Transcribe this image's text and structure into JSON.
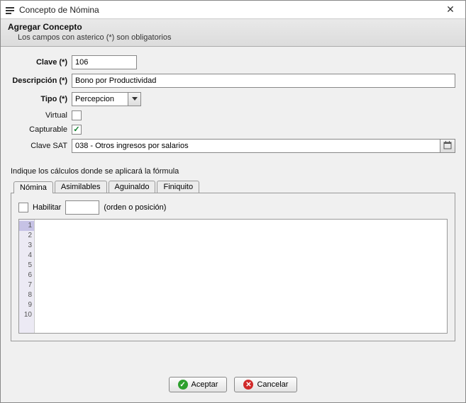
{
  "window": {
    "title": "Concepto de Nómina"
  },
  "header": {
    "title": "Agregar Concepto",
    "subtitle": "Los campos con asterico (*) son obligatorios"
  },
  "form": {
    "clave_label": "Clave (*)",
    "clave_value": "106",
    "descripcion_label": "Descripción (*)",
    "descripcion_value": "Bono por Productividad",
    "tipo_label": "Tipo (*)",
    "tipo_value": "Percepcion",
    "virtual_label": "Virtual",
    "virtual_checked": false,
    "capturable_label": "Capturable",
    "capturable_checked": true,
    "clavesat_label": "Clave SAT",
    "clavesat_value": "038 - Otros ingresos por salarios"
  },
  "tabs": {
    "instruction": "Indique los cálculos donde se aplicará la fórmula",
    "items": [
      "Nómina",
      "Asimilables",
      "Aguinaldo",
      "Finiquito"
    ],
    "active_index": 0,
    "panel": {
      "habilitar_label": "Habilitar",
      "habilitar_checked": false,
      "orden_value": "",
      "orden_hint": "(orden o posición)",
      "line_numbers": [
        "1",
        "2",
        "3",
        "4",
        "5",
        "6",
        "7",
        "8",
        "9",
        "10"
      ]
    }
  },
  "buttons": {
    "accept": "Aceptar",
    "cancel": "Cancelar"
  }
}
